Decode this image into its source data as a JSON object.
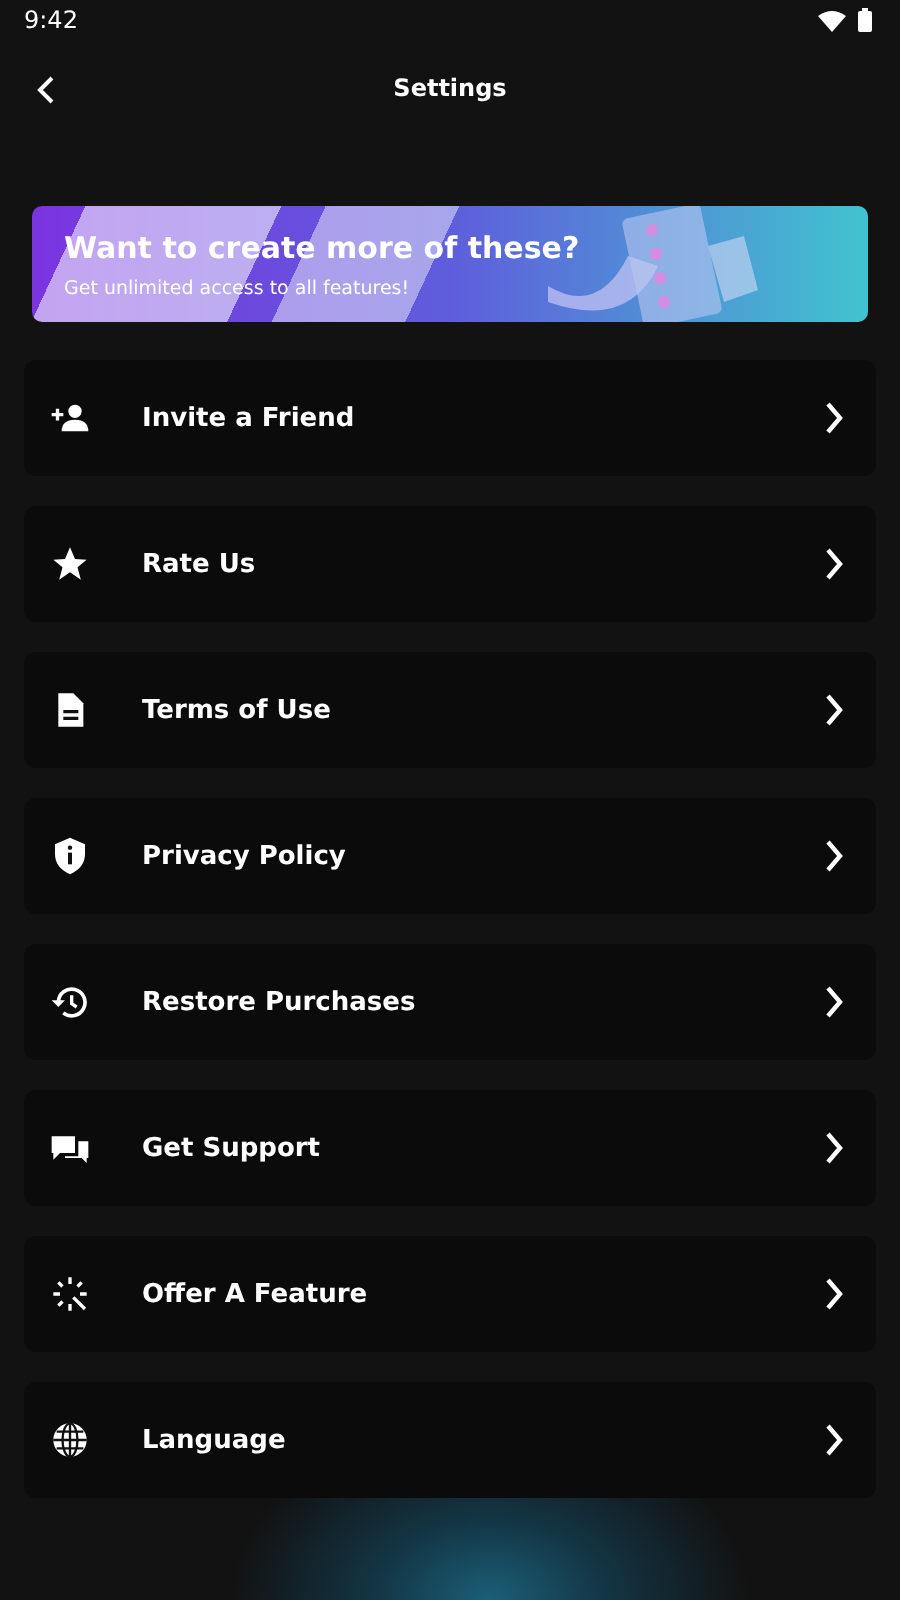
{
  "status_bar": {
    "time": "9:42"
  },
  "header": {
    "title": "Settings"
  },
  "banner": {
    "title": "Want to create more of these?",
    "subtitle": "Get unlimited access to all features!"
  },
  "items": [
    {
      "label": "Invite a Friend",
      "kind": "invite"
    },
    {
      "label": "Rate Us",
      "kind": "star"
    },
    {
      "label": "Terms of Use",
      "kind": "document"
    },
    {
      "label": "Privacy Policy",
      "kind": "shield"
    },
    {
      "label": "Restore Purchases",
      "kind": "history"
    },
    {
      "label": "Get Support",
      "kind": "chat"
    },
    {
      "label": "Offer A Feature",
      "kind": "sparkle"
    },
    {
      "label": "Language",
      "kind": "globe"
    }
  ]
}
